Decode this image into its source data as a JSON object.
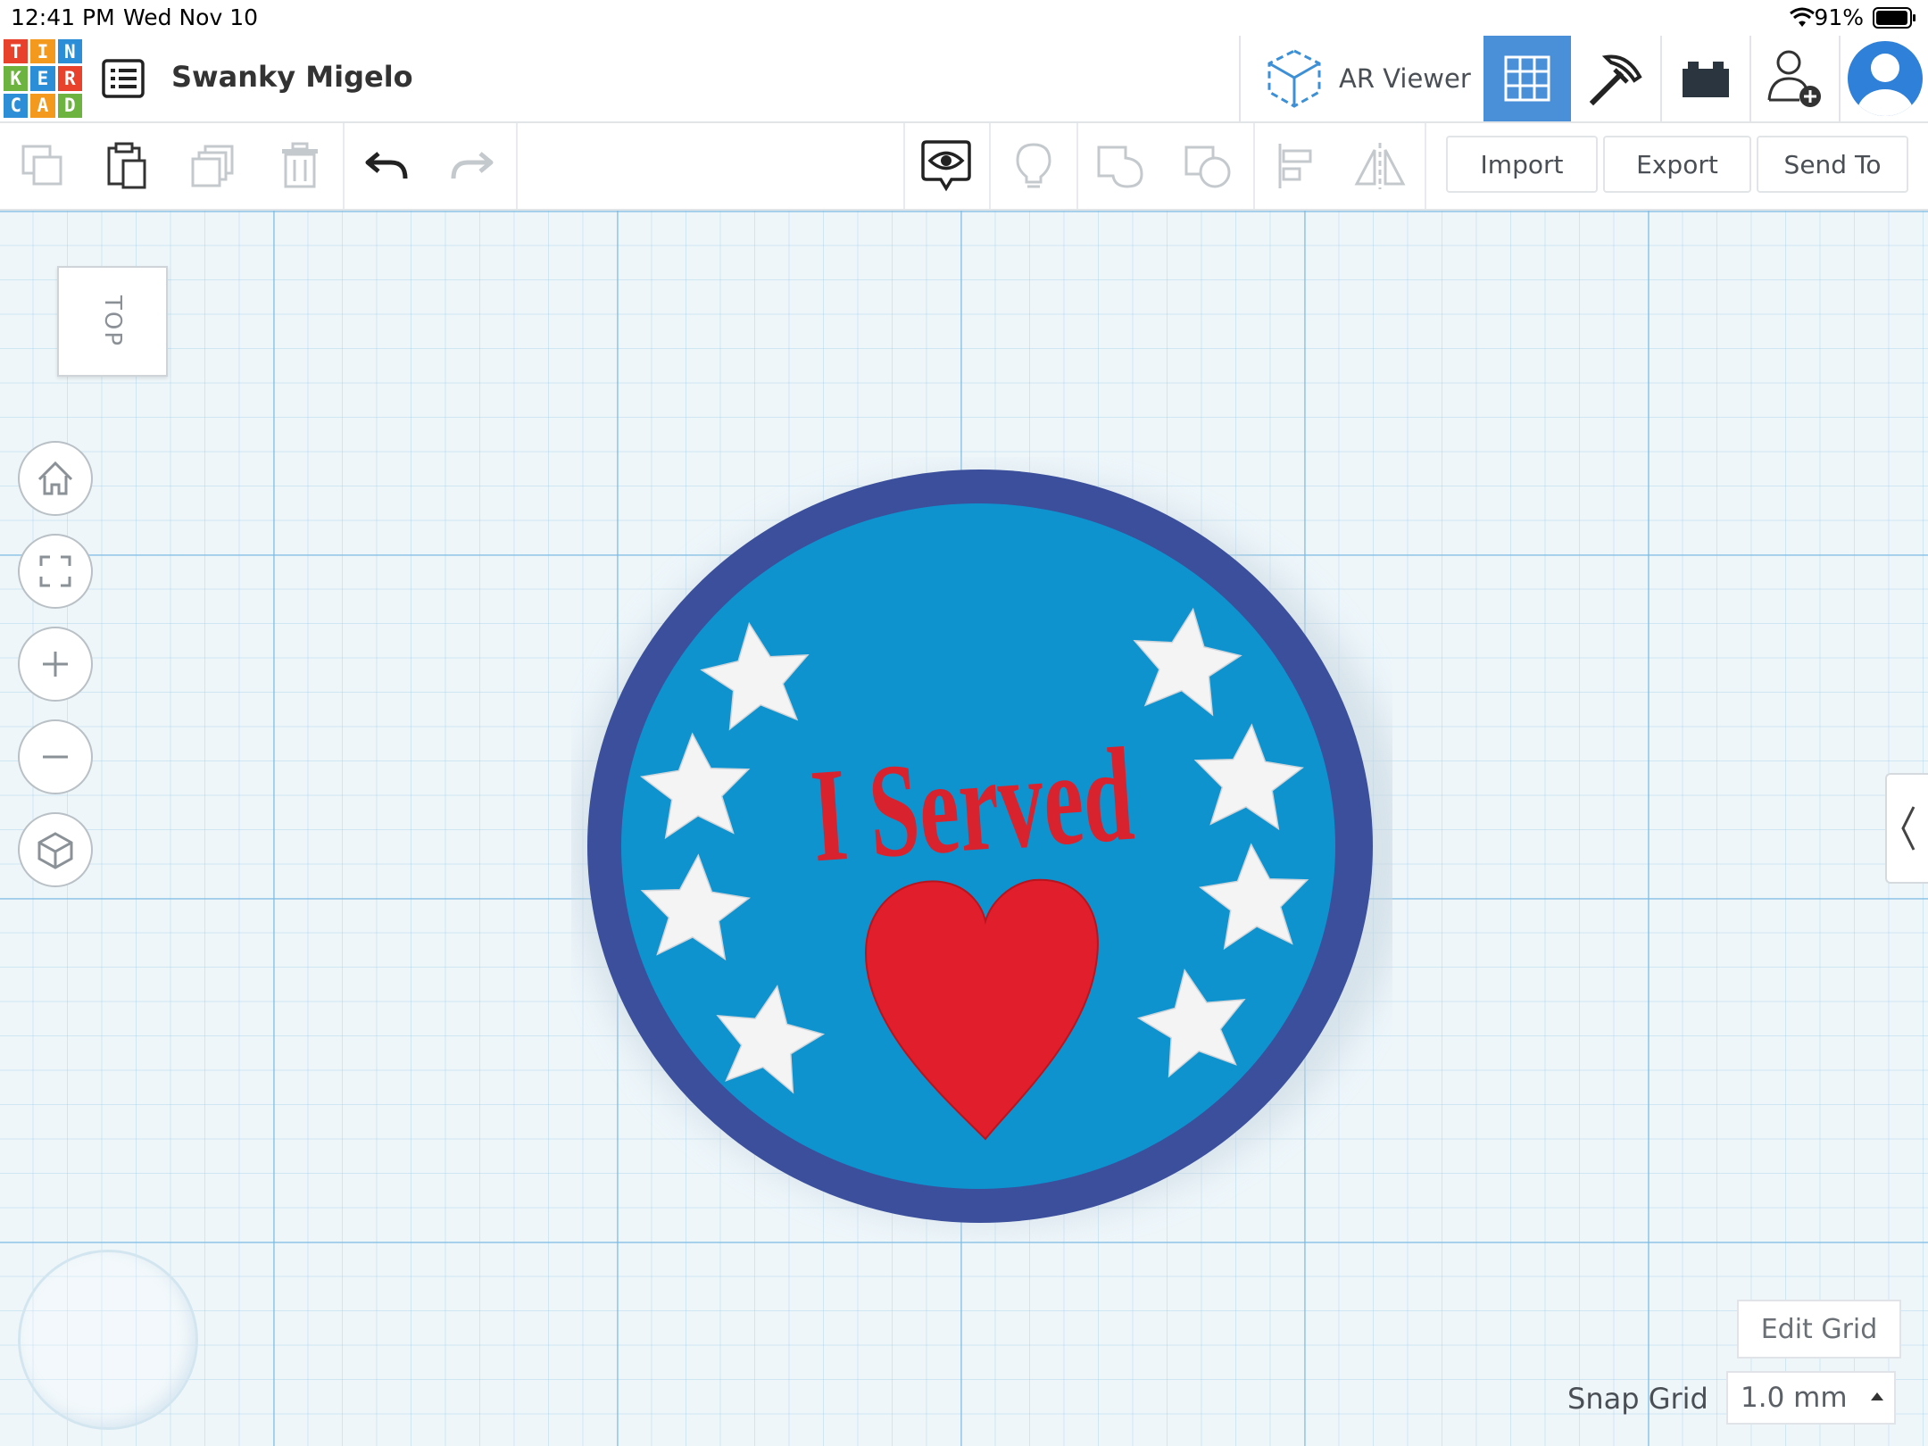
{
  "status_bar": {
    "time": "12:41 PM",
    "date": "Wed Nov 10",
    "battery": "91%"
  },
  "logo": {
    "letters": [
      "T",
      "I",
      "N",
      "K",
      "E",
      "R",
      "C",
      "A",
      "D"
    ],
    "colors": [
      "#e8412c",
      "#f39a1e",
      "#2b8ed6",
      "#6cb33f",
      "#2b8ed6",
      "#e8412c",
      "#2b8ed6",
      "#f39a1e",
      "#6cb33f"
    ]
  },
  "header": {
    "design_title": "Swanky Migelo",
    "ar_viewer_label": "AR Viewer",
    "icons": [
      "cube-ar-icon",
      "grid-icon",
      "pickaxe-icon",
      "brick-icon",
      "add-user-icon",
      "avatar"
    ]
  },
  "toolbar": {
    "import_label": "Import",
    "export_label": "Export",
    "send_to_label": "Send To"
  },
  "workplane": {
    "view_cube_label": "TOP",
    "edit_grid_label": "Edit Grid",
    "snap_grid_label": "Snap Grid",
    "snap_grid_value": "1.0 mm"
  },
  "badge": {
    "text": "I Served",
    "colors": {
      "ring": "#3b4f9c",
      "face": "#0e93cf",
      "text": "#d8232e",
      "heart": "#e01e2c",
      "star": "#f4f4f4"
    }
  },
  "accent_color": "#4a90d9"
}
